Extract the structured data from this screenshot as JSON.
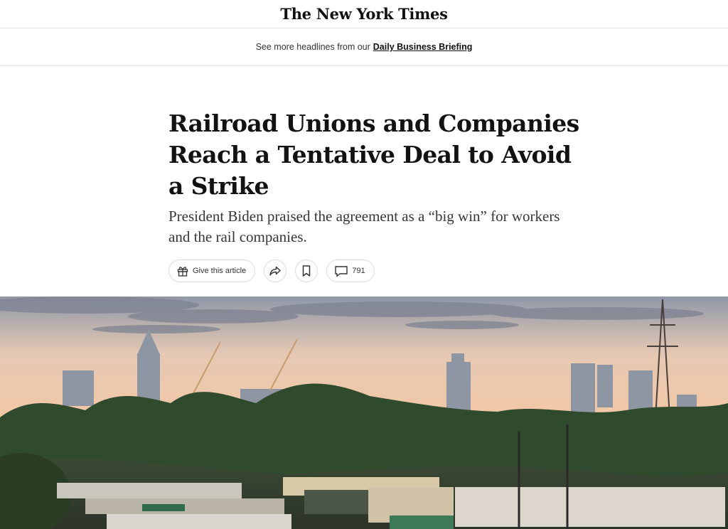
{
  "masthead": {
    "logo_text": "The New York Times"
  },
  "briefing": {
    "prefix": "See more headlines from our",
    "link_label": "Daily Business Briefing"
  },
  "article": {
    "headline": "Railroad Unions and Companies Reach a Tentative Deal to Avoid a Strike",
    "summary": "President Biden praised the agreement as a “big win” for workers and the rail companies."
  },
  "actions": {
    "gift_label": "Give this article",
    "comment_count": "791",
    "icons": [
      "gift-icon",
      "share-icon",
      "bookmark-icon",
      "comment-icon"
    ]
  },
  "photo": {
    "subject": "rail-yard-city-skyline-sunset"
  }
}
